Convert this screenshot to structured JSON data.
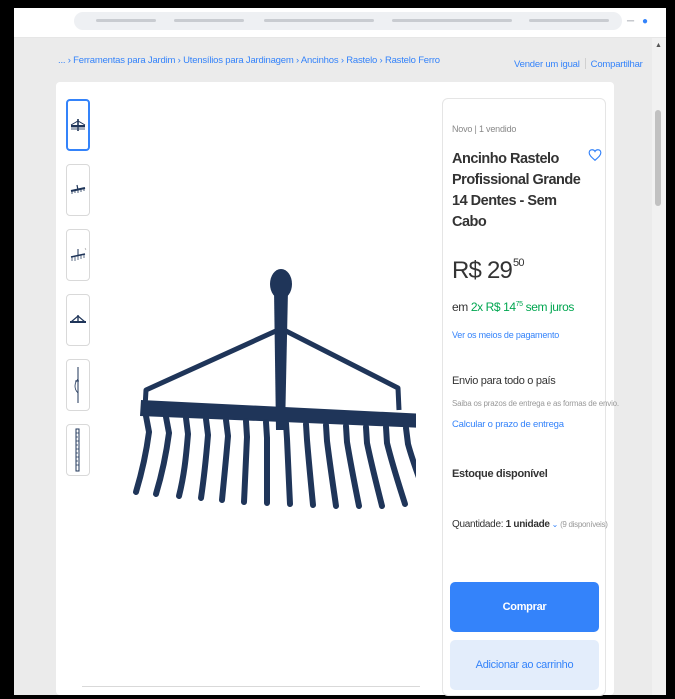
{
  "breadcrumb": {
    "items": [
      "... › Ferramentas para Jardim",
      "Utensílios para Jardinagem",
      "Ancinhos",
      "Rastelo",
      "Rastelo Ferro"
    ],
    "separator": "›"
  },
  "top_links": {
    "sell_label": "Vender um igual",
    "share_label": "Compartilhar"
  },
  "thumbnails": [
    {
      "icon": "rake-front-thumbnail-icon"
    },
    {
      "icon": "rake-angle-thumbnail-icon"
    },
    {
      "icon": "rake-side-thumbnail-icon"
    },
    {
      "icon": "rake-top-thumbnail-icon"
    },
    {
      "icon": "rake-profile-thumbnail-icon"
    },
    {
      "icon": "ruler-thumbnail-icon"
    }
  ],
  "product": {
    "condition": "Novo  |  1 vendido",
    "title": "Ancinho Rastelo Profissional Grande 14 Dentes - Sem Cabo",
    "price": {
      "currency_whole": "R$ 29",
      "cents": "50"
    },
    "installments": {
      "prefix": "em ",
      "count": "2x R$ 14",
      "cents": "75",
      "suffix": " sem juros"
    },
    "payment_link": "Ver os meios de pagamento",
    "shipping": {
      "title": "Envio para todo o país",
      "subtitle": "Saiba os prazos de entrega e as formas de envio.",
      "link": "Calcular o prazo de entrega"
    },
    "stock": "Estoque disponível",
    "quantity": {
      "label": "Quantidade: ",
      "value": "1 unidade",
      "available": "(9 disponíveis)"
    },
    "buy_label": "Comprar",
    "cart_label": "Adicionar ao carrinho"
  },
  "colors": {
    "accent": "#3483fa",
    "success": "#00a650",
    "page_bg": "#ebebeb",
    "rake": "#1f3559"
  }
}
